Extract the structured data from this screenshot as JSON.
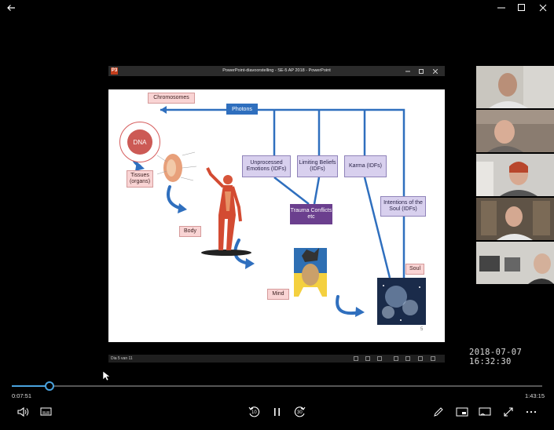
{
  "window": {
    "back_icon": "arrow-left-icon",
    "minimize_icon": "minimize-icon",
    "maximize_icon": "maximize-icon",
    "close_icon": "close-icon"
  },
  "ppt_window": {
    "logo": "P3",
    "title": "PowerPoint-diavoorstelling  -  SE-5 AP 2018 - PowerPoint",
    "status_text": "Dia 5 van 11"
  },
  "slide": {
    "chromosomes": "Chromosomes",
    "dna": "DNA",
    "photons": "Photons",
    "tissues": "Tissues (organs)",
    "body": "Body",
    "mind": "Mind",
    "soul": "Soul",
    "unprocessed": "Unprocessed Emotions (IDFs)",
    "limiting": "Limiting Beliefs (IDFs)",
    "karma": "Karma (IDFs)",
    "trauma": "Trauma Conflicts etc",
    "intentions": "Intentions of the Soul (IDFs)",
    "slide_number": "5",
    "colors": {
      "blue": "#2f6fbe",
      "lavender": "#d8d0ee",
      "pink": "#f9d4d4",
      "dark_purple": "#6b3f8e",
      "dna_red": "#cc5a55"
    }
  },
  "participants": [
    {
      "name": "participant-1"
    },
    {
      "name": "participant-2"
    },
    {
      "name": "participant-3"
    },
    {
      "name": "participant-4"
    },
    {
      "name": "participant-5"
    }
  ],
  "overlay": {
    "timestamp": "2018-07-07  16:32:30"
  },
  "player": {
    "elapsed": "0:07:51",
    "remaining": "1:43:15",
    "progress": 0.0706,
    "rewind_label": "10",
    "forward_label": "30",
    "colors": {
      "accent": "#4aa3df"
    }
  }
}
